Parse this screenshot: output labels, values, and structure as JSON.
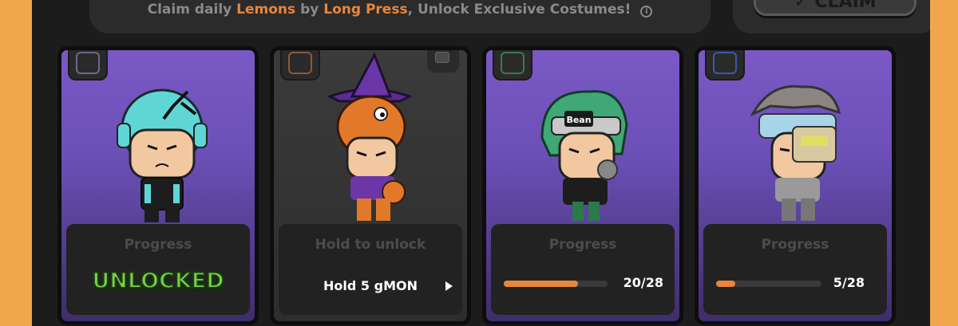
{
  "banner": {
    "prefix": "Claim daily",
    "lemons": "Lemons",
    "middle": "by",
    "long_press": "Long Press",
    "suffix": ", Unlock Exclusive Costumes!",
    "info_icon": "i"
  },
  "claim": {
    "label": "CLAIM"
  },
  "cards": [
    {
      "label": "Progress",
      "status": "UNLOCKED",
      "avatar": "helmet-character",
      "bg": "purple"
    },
    {
      "label": "Hold to unlock",
      "requirement": "Hold 5 gMON",
      "avatar": "wizard-dino-character",
      "bg": "grey"
    },
    {
      "label": "Progress",
      "progress_current": 20,
      "progress_total": 28,
      "progress_text": "20/28",
      "avatar": "bean-headband-character",
      "bg": "purple"
    },
    {
      "label": "Progress",
      "progress_current": 5,
      "progress_total": 28,
      "progress_text": "5/28",
      "avatar": "cyborg-visor-character",
      "bg": "purple"
    }
  ],
  "colors": {
    "accent": "#e8863a",
    "unlocked": "#78d04a",
    "card_purple": "#7a59c5"
  }
}
